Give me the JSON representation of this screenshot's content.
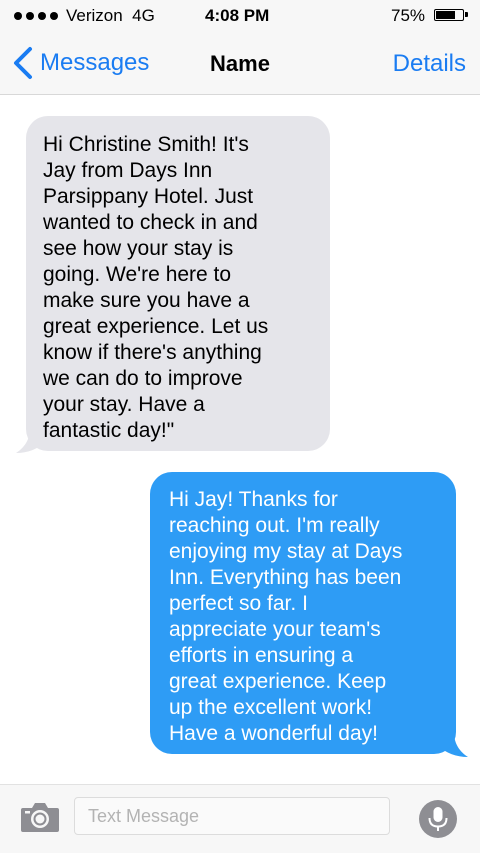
{
  "status_bar": {
    "carrier": "Verizon",
    "network": "4G",
    "time": "4:08 PM",
    "battery_text": "75%",
    "battery_level": 0.75
  },
  "nav": {
    "back_label": "Messages",
    "title": "Name",
    "details_label": "Details"
  },
  "messages": [
    {
      "direction": "incoming",
      "text": "Hi Christine Smith! It's\nJay from Days Inn\nParsippany Hotel. Just\nwanted to check in and\nsee how your stay is\ngoing. We're here to\nmake sure you have a\ngreat experience. Let us\nknow if there's anything\nwe can do to improve\nyour stay. Have a\nfantastic day!\""
    },
    {
      "direction": "outgoing",
      "text": "Hi Jay! Thanks for\nreaching out. I'm really\nenjoying my stay at Days\nInn. Everything has been\nperfect so far. I\nappreciate your team's\nefforts in ensuring a\ngreat experience. Keep\nup the excellent work!\nHave a wonderful day!"
    }
  ],
  "composer": {
    "placeholder": "Text Message",
    "value": ""
  },
  "colors": {
    "accent": "#1a7cf2",
    "incoming_bubble": "#e5e5ea",
    "outgoing_bubble": "#2e9cf5",
    "bar_background": "#f7f7f7",
    "icon_gray": "#8e8e93"
  },
  "icons": {
    "signal": "signal-dots-icon",
    "battery": "battery-icon",
    "back": "chevron-left-icon",
    "camera": "camera-icon",
    "mic": "microphone-icon"
  }
}
